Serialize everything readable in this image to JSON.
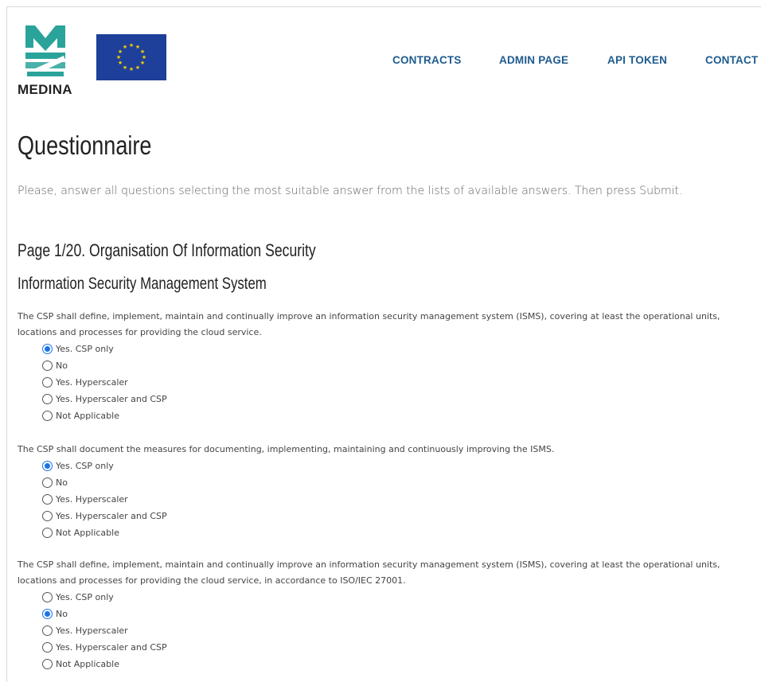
{
  "header": {
    "logo_text": "MEDINA",
    "nav": [
      "CONTRACTS",
      "ADMIN PAGE",
      "API TOKEN",
      "CONTACT"
    ]
  },
  "page": {
    "title": "Questionnaire",
    "intro": "Please, answer all questions selecting the most suitable answer from the lists of available answers. Then press Submit.",
    "page_heading": "Page 1/20. Organisation Of Information Security",
    "section_heading": "Information Security Management System"
  },
  "questions": [
    {
      "text_lines": [
        "The CSP shall define, implement, maintain and continually improve an information security management system (ISMS), covering at least the operational units,",
        "locations and processes for providing the cloud service."
      ],
      "options": [
        "Yes. CSP only",
        "No",
        "Yes. Hyperscaler",
        "Yes. Hyperscaler and CSP",
        "Not Applicable"
      ],
      "selected": "Yes. CSP only"
    },
    {
      "text_lines": [
        "The CSP shall document the measures for documenting, implementing, maintaining and continuously improving the ISMS."
      ],
      "options": [
        "Yes. CSP only",
        "No",
        "Yes. Hyperscaler",
        "Yes. Hyperscaler and CSP",
        "Not Applicable"
      ],
      "selected": "Yes. CSP only"
    },
    {
      "text_lines": [
        "The CSP shall define, implement, maintain and continually improve an information security management system (ISMS), covering at least the operational units,",
        "locations and processes for providing the cloud service, in accordance to ISO/IEC 27001."
      ],
      "options": [
        "Yes. CSP only",
        "No",
        "Yes. Hyperscaler",
        "Yes. Hyperscaler and CSP",
        "Not Applicable"
      ],
      "selected": "No"
    }
  ],
  "colors": {
    "nav": "#1e5b8e",
    "radio_checked": "#1a73e8",
    "logo_teal": "#2aa39a",
    "eu_blue": "#1e3f9a",
    "eu_star": "#f5d200"
  }
}
